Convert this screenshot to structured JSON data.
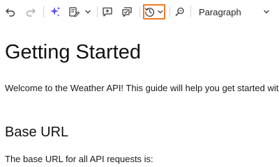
{
  "toolbar": {
    "icons": {
      "undo": "undo-icon",
      "redo": "redo-icon",
      "ai": "ai-sparkle-icon",
      "edit": "edit-document-icon",
      "comment": "add-comment-icon",
      "comments": "comments-icon",
      "history": "history-icon",
      "find": "find-replace-icon",
      "chevron": "chevron-down-icon"
    },
    "format_select": {
      "value": "Paragraph"
    },
    "colors": {
      "ai_accent": "#5b4ff0",
      "icon": "#3c3c3c",
      "disabled": "#a8a8a8",
      "highlight": "#f07a25"
    }
  },
  "document": {
    "title": "Getting Started",
    "intro": "Welcome to the Weather API! This guide will help you get started with",
    "section_heading": "Base URL",
    "section_text": "The base URL for all API requests is:"
  }
}
